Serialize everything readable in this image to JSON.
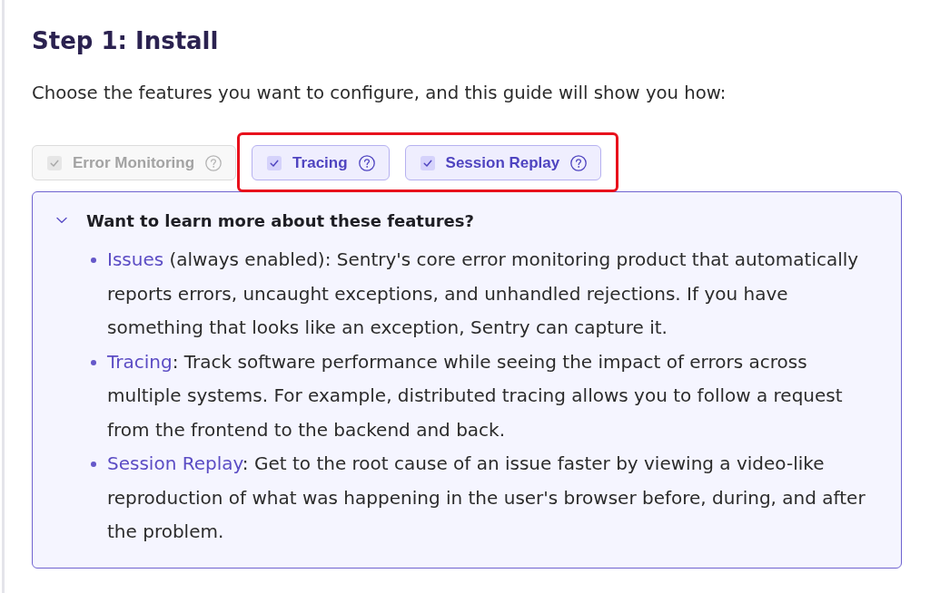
{
  "heading": "Step 1: Install",
  "intro": "Choose the features you want to configure, and this guide will show you how:",
  "options": [
    {
      "label": "Error Monitoring",
      "checked": true,
      "disabled": true,
      "highlighted": false
    },
    {
      "label": "Tracing",
      "checked": true,
      "disabled": false,
      "highlighted": true
    },
    {
      "label": "Session Replay",
      "checked": true,
      "disabled": false,
      "highlighted": true
    }
  ],
  "details": {
    "title": "Want to learn more about these features?",
    "expanded": true,
    "items": [
      {
        "term": "Issues",
        "text": " (always enabled): Sentry's core error monitoring product that automatically reports errors, uncaught exceptions, and unhandled rejections. If you have something that looks like an exception, Sentry can capture it."
      },
      {
        "term": "Tracing",
        "text": ": Track software performance while seeing the impact of errors across multiple systems. For example, distributed tracing allows you to follow a request from the frontend to the backend and back."
      },
      {
        "term": "Session Replay",
        "text": ": Get to the root cause of an issue faster by viewing a video-like reproduction of what was happening in the user's browser before, during, and after the problem."
      }
    ]
  }
}
